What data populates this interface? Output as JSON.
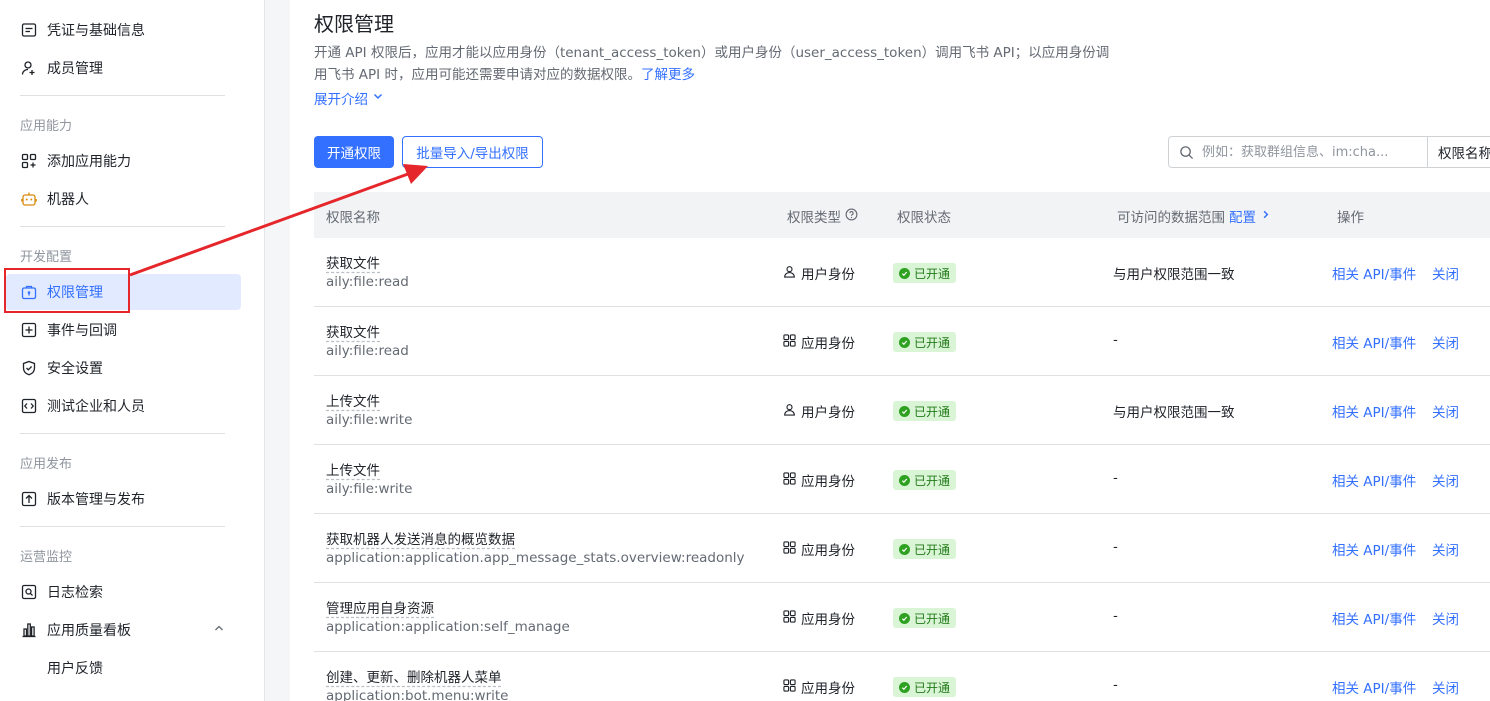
{
  "sidebar": {
    "items": [
      {
        "label": "凭证与基础信息"
      },
      {
        "label": "成员管理"
      },
      {
        "label": "添加应用能力"
      },
      {
        "label": "机器人"
      },
      {
        "label": "权限管理"
      },
      {
        "label": "事件与回调"
      },
      {
        "label": "安全设置"
      },
      {
        "label": "测试企业和人员"
      },
      {
        "label": "版本管理与发布"
      },
      {
        "label": "日志检索"
      },
      {
        "label": "应用质量看板"
      },
      {
        "label": "用户反馈"
      }
    ],
    "sections": [
      "应用能力",
      "开发配置",
      "应用发布",
      "运营监控"
    ],
    "active_color": "#3370ff"
  },
  "main": {
    "title": "权限管理",
    "desc_line1": "开通 API 权限后，应用才能以应用身份（tenant_access_token）或用户身份（user_access_token）调用飞书 API；以应用身份调",
    "desc_line2": "用飞书 API 时，应用可能还需要申请对应的数据权限。",
    "learn_more": "了解更多",
    "expand": "展开介绍",
    "btn_enable": "开通权限",
    "btn_batch": "批量导入/导出权限",
    "search_placeholder": "例如：获取群组信息、im:cha...",
    "search_select": "权限名称"
  },
  "table": {
    "headers": {
      "name": "权限名称",
      "type": "权限类型",
      "status": "权限状态",
      "scope": "可访问的数据范围",
      "scope_link": "配置",
      "actions": "操作"
    },
    "rows": [
      {
        "name": "获取文件",
        "code": "aily:file:read",
        "type": "用户身份",
        "type_icon": "user-icon",
        "status": "已开通",
        "scope": "与用户权限范围一致",
        "act1": "相关 API/事件",
        "act2": "关闭"
      },
      {
        "name": "获取文件",
        "code": "aily:file:read",
        "type": "应用身份",
        "type_icon": "app-grid-icon",
        "status": "已开通",
        "scope": "-",
        "act1": "相关 API/事件",
        "act2": "关闭"
      },
      {
        "name": "上传文件",
        "code": "aily:file:write",
        "type": "用户身份",
        "type_icon": "user-icon",
        "status": "已开通",
        "scope": "与用户权限范围一致",
        "act1": "相关 API/事件",
        "act2": "关闭"
      },
      {
        "name": "上传文件",
        "code": "aily:file:write",
        "type": "应用身份",
        "type_icon": "app-grid-icon",
        "status": "已开通",
        "scope": "-",
        "act1": "相关 API/事件",
        "act2": "关闭"
      },
      {
        "name": "获取机器人发送消息的概览数据",
        "code": "application:application.app_message_stats.overview:readonly",
        "type": "应用身份",
        "type_icon": "app-grid-icon",
        "status": "已开通",
        "scope": "-",
        "act1": "相关 API/事件",
        "act2": "关闭"
      },
      {
        "name": "管理应用自身资源",
        "code": "application:application:self_manage",
        "type": "应用身份",
        "type_icon": "app-grid-icon",
        "status": "已开通",
        "scope": "-",
        "act1": "相关 API/事件",
        "act2": "关闭"
      },
      {
        "name": "创建、更新、删除机器人菜单",
        "code": "application:bot.menu:write",
        "type": "应用身份",
        "type_icon": "app-grid-icon",
        "status": "已开通",
        "scope": "-",
        "act1": "相关 API/事件",
        "act2": "关闭"
      }
    ]
  },
  "annotation_color": "#e5262b"
}
